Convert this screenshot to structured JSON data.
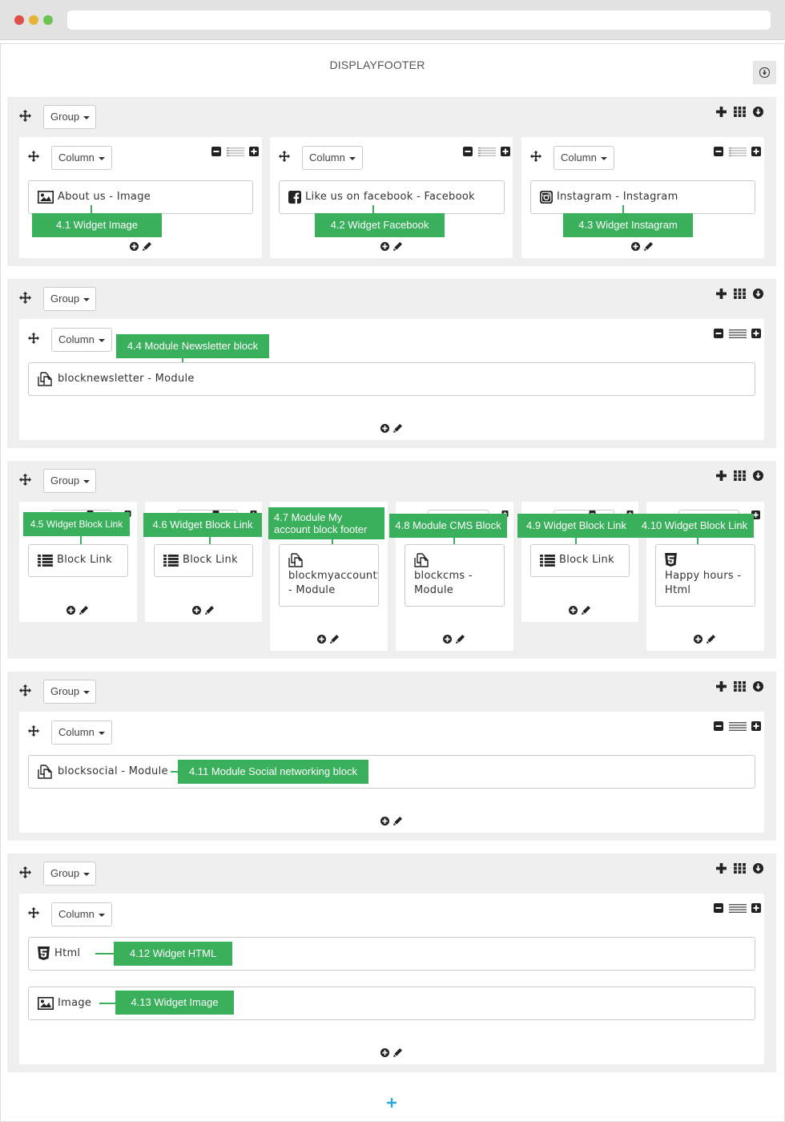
{
  "page": {
    "title": "DISPLAYFOOTER",
    "group_label": "Group",
    "column_label": "Column"
  },
  "colors": {
    "tag_green": "#3aaf5c",
    "group_bg": "#efefef",
    "add_blue": "#2aa6de"
  },
  "icons": {
    "move": "move-icon",
    "plus": "plus-icon",
    "grid": "grid-icon",
    "collapse": "collapse-icon",
    "minus": "minus-icon",
    "lines": "lines-icon",
    "add_circle": "add-circle-icon",
    "pencil": "pencil-icon"
  },
  "groups": [
    {
      "columns": [
        {
          "widgets": [
            {
              "label": "About us - Image",
              "icon": "image-icon"
            }
          ],
          "tag": "4.1 Widget Image"
        },
        {
          "widgets": [
            {
              "label": "Like us on facebook - Facebook",
              "icon": "facebook-icon"
            }
          ],
          "tag": "4.2 Widget Facebook"
        },
        {
          "widgets": [
            {
              "label": "Instagram - Instagram",
              "icon": "instagram-icon"
            }
          ],
          "tag": "4.3 Widget Instagram"
        }
      ]
    },
    {
      "columns": [
        {
          "widgets": [
            {
              "label": "blocknewsletter - Module",
              "icon": "module-icon"
            }
          ],
          "tag": "4.4 Module Newsletter block"
        }
      ]
    },
    {
      "columns": [
        {
          "widgets": [
            {
              "label": "Block Link",
              "icon": "list-icon"
            }
          ],
          "tag": "4.5 Widget Block Link"
        },
        {
          "widgets": [
            {
              "label": "Block Link",
              "icon": "list-icon"
            }
          ],
          "tag": "4.6 Widget Block Link"
        },
        {
          "widgets": [
            {
              "label_line1": "blockmyaccountfooter",
              "label_line2": "- Module",
              "icon": "module-icon"
            }
          ],
          "tag_line1": "4.7 Module My",
          "tag_line2": "account block footer"
        },
        {
          "widgets": [
            {
              "label_line1": "blockcms -",
              "label_line2": "Module",
              "icon": "module-icon"
            }
          ],
          "tag": "4.8 Module CMS Block"
        },
        {
          "widgets": [
            {
              "label": "Block Link",
              "icon": "list-icon"
            }
          ],
          "tag": "4.9 Widget Block Link"
        },
        {
          "widgets": [
            {
              "label_line1": "Happy hours -",
              "label_line2": "Html",
              "icon": "html5-icon"
            }
          ],
          "tag": "4.10 Widget Block Link"
        }
      ]
    },
    {
      "columns": [
        {
          "widgets": [
            {
              "label": "blocksocial - Module",
              "icon": "module-icon"
            }
          ],
          "tag": "4.11 Module Social networking block"
        }
      ]
    },
    {
      "columns": [
        {
          "widgets": [
            {
              "label": "Html",
              "icon": "html5-icon",
              "tag": "4.12 Widget HTML"
            },
            {
              "label": "Image",
              "icon": "image-icon",
              "tag": "4.13 Widget Image"
            }
          ]
        }
      ]
    }
  ]
}
